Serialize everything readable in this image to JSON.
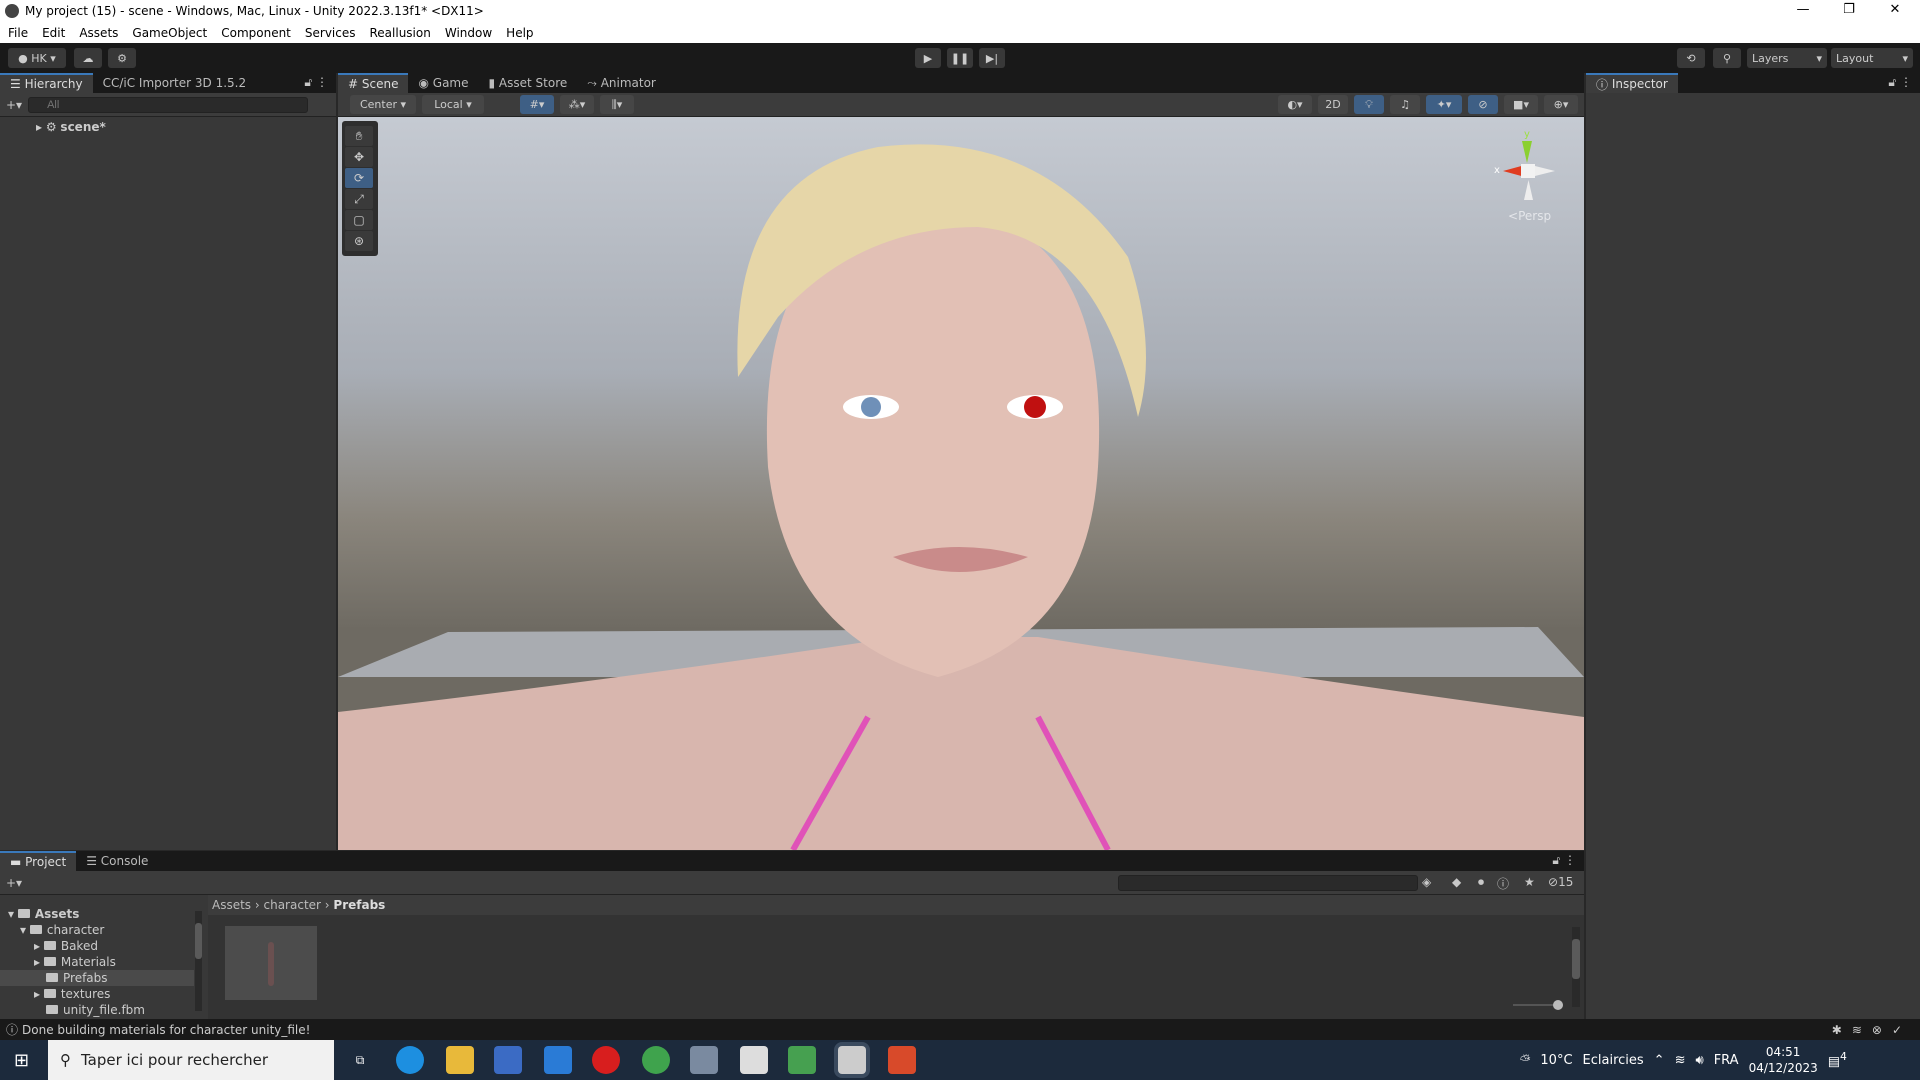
{
  "window": {
    "title": "My project (15) - scene - Windows, Mac, Linux - Unity 2022.3.13f1* <DX11>"
  },
  "menu": [
    "File",
    "Edit",
    "Assets",
    "GameObject",
    "Component",
    "Services",
    "Reallusion",
    "Window",
    "Help"
  ],
  "toolbar": {
    "account": "HK",
    "layers": "Layers",
    "layout": "Layout"
  },
  "hierarchy": {
    "tabs": [
      "Hierarchy",
      "CC/iC Importer 3D 1.5.2"
    ],
    "search_placeholder": "All",
    "items": [
      "scene*"
    ]
  },
  "scene": {
    "tabs": [
      "Scene",
      "Game",
      "Asset Store",
      "Animator"
    ],
    "pivot": "Center",
    "space": "Local",
    "mode_2d": "2D",
    "gizmo_label": "Persp",
    "gizmo_axes": [
      "y",
      "x"
    ]
  },
  "inspector": {
    "tab": "Inspector"
  },
  "project": {
    "tabs": [
      "Project",
      "Console"
    ],
    "breadcrumb": [
      "Assets",
      "character",
      "Prefabs"
    ],
    "hidden_count": "15",
    "tree": [
      {
        "label": "Assets",
        "level": 0,
        "bold": true
      },
      {
        "label": "character",
        "level": 1
      },
      {
        "label": "Baked",
        "level": 2
      },
      {
        "label": "Materials",
        "level": 2
      },
      {
        "label": "Prefabs",
        "level": 2,
        "selected": true
      },
      {
        "label": "textures",
        "level": 2
      },
      {
        "label": "unity_file.fbm",
        "level": 2
      }
    ]
  },
  "status": {
    "message": "Done building materials for character unity_file!"
  },
  "taskbar": {
    "search_placeholder": "Taper ici pour rechercher",
    "weather": "10°C",
    "weather_desc": "Eclaircies",
    "lang": "FRA",
    "time": "04:51",
    "date": "04/12/2023",
    "notifications": "4"
  },
  "colors": {
    "accent": "#3a79bb",
    "toolbar": "#191919",
    "panel": "#383838"
  }
}
